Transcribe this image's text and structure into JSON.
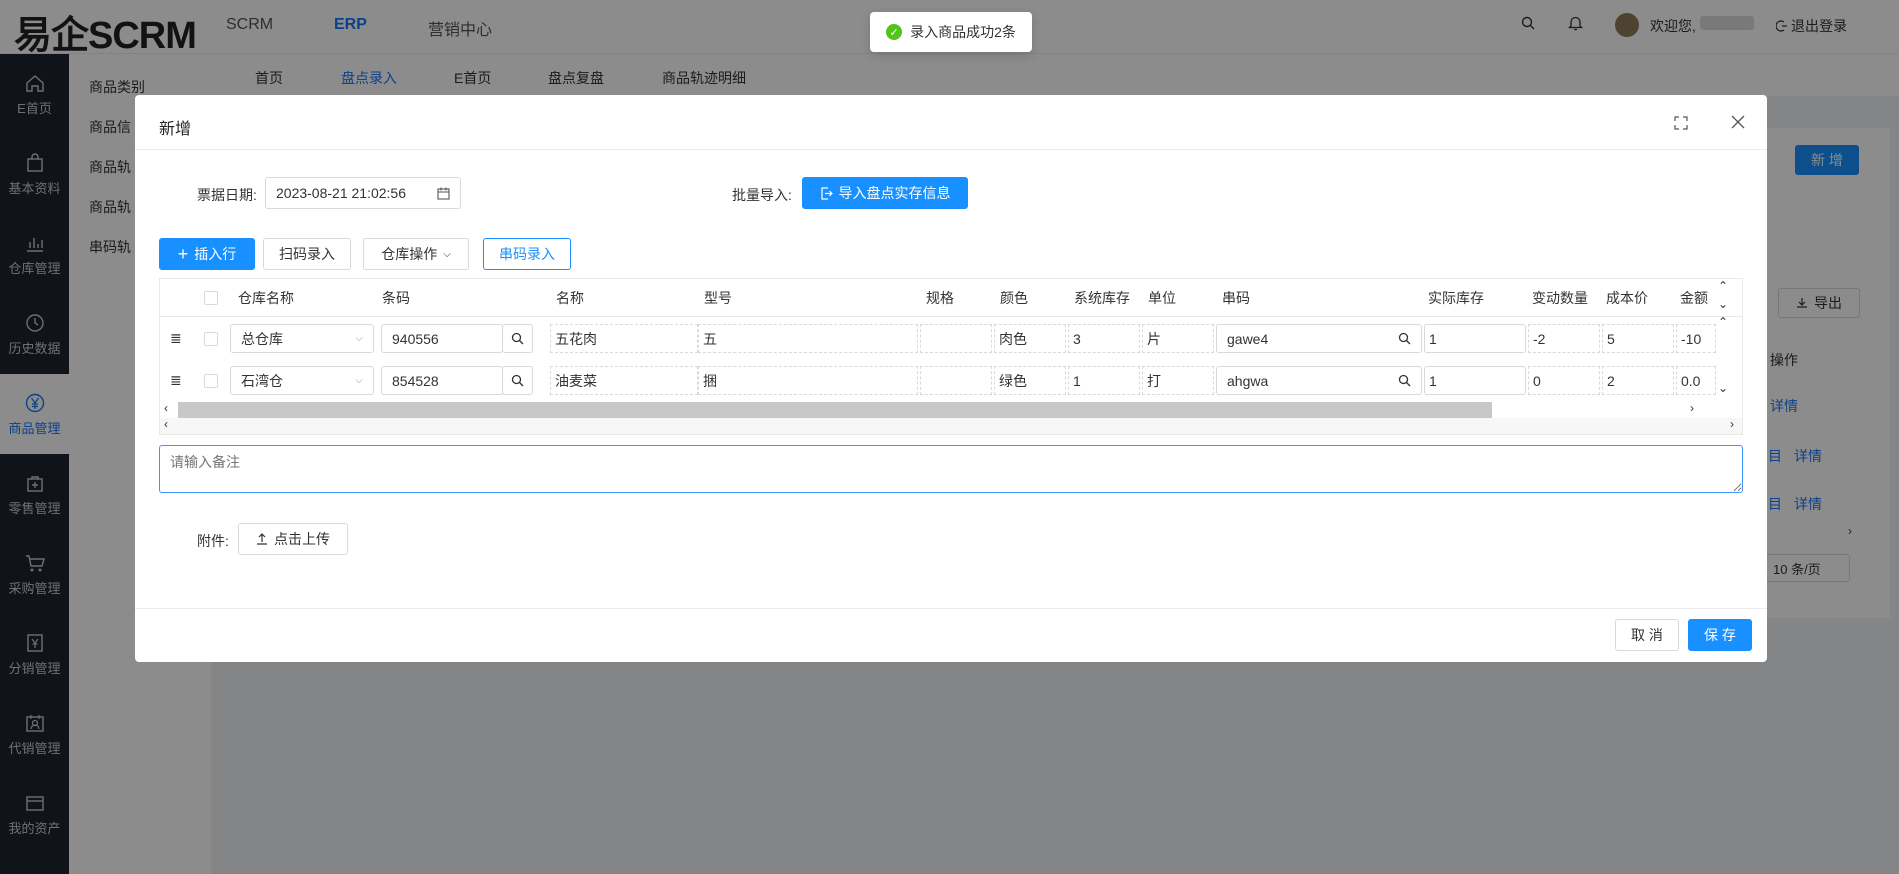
{
  "header": {
    "logo": "易企SCRM",
    "nav": [
      "SCRM",
      "ERP",
      "营销中心"
    ],
    "welcome": "欢迎您,",
    "logout": "退出登录"
  },
  "sidebar": {
    "items": [
      {
        "label": "E首页",
        "icon": "home-icon"
      },
      {
        "label": "基本资料",
        "icon": "bag-icon"
      },
      {
        "label": "仓库管理",
        "icon": "bar-chart-icon"
      },
      {
        "label": "历史数据",
        "icon": "clock-icon"
      },
      {
        "label": "商品管理",
        "icon": "yen-icon"
      },
      {
        "label": "零售管理",
        "icon": "shop-icon"
      },
      {
        "label": "采购管理",
        "icon": "cart-icon"
      },
      {
        "label": "分销管理",
        "icon": "yen-doc-icon"
      },
      {
        "label": "代销管理",
        "icon": "id-card-icon"
      },
      {
        "label": "我的资产",
        "icon": "wallet-icon"
      }
    ]
  },
  "subnav": [
    "商品类别",
    "商品信",
    "商品轨",
    "商品轨",
    "串码轨"
  ],
  "tabs": [
    "首页",
    "盘点录入",
    "E首页",
    "盘点复盘",
    "商品轨迹明细"
  ],
  "background": {
    "new_button": "新 增",
    "export_button": "导出",
    "ops_header": "操作",
    "detail_links": [
      "详情",
      "详情",
      "详情"
    ],
    "edit_partials": [
      "目",
      "目"
    ],
    "page_size": "10 条/页"
  },
  "toast": {
    "text": "录入商品成功2条"
  },
  "modal": {
    "title": "新增",
    "date_label": "票据日期:",
    "date_value": "2023-08-21 21:02:56",
    "batch_label": "批量导入:",
    "import_button": "导入盘点实存信息",
    "insert_row": "插入行",
    "scan_entry": "扫码录入",
    "warehouse_ops": "仓库操作",
    "serial_entry": "串码录入",
    "columns": [
      "仓库名称",
      "条码",
      "名称",
      "型号",
      "规格",
      "颜色",
      "系统库存",
      "单位",
      "串码",
      "实际库存",
      "变动数量",
      "成本价",
      "金额"
    ],
    "rows": [
      {
        "warehouse": "总仓库",
        "barcode": "940556",
        "name": "五花肉",
        "model": "五",
        "spec": "",
        "color": "肉色",
        "stock": "3",
        "unit": "片",
        "serial": "gawe4",
        "actual": "1",
        "change": "-2",
        "cost": "5",
        "amount": "-10"
      },
      {
        "warehouse": "石湾仓",
        "barcode": "854528",
        "name": "油麦菜",
        "model": "捆",
        "spec": "",
        "color": "绿色",
        "stock": "1",
        "unit": "打",
        "serial": "ahgwa",
        "actual": "1",
        "change": "0",
        "cost": "2",
        "amount": "0.0"
      }
    ],
    "remark_placeholder": "请输入备注",
    "attachment_label": "附件:",
    "upload_button": "点击上传",
    "cancel": "取 消",
    "save": "保 存"
  }
}
